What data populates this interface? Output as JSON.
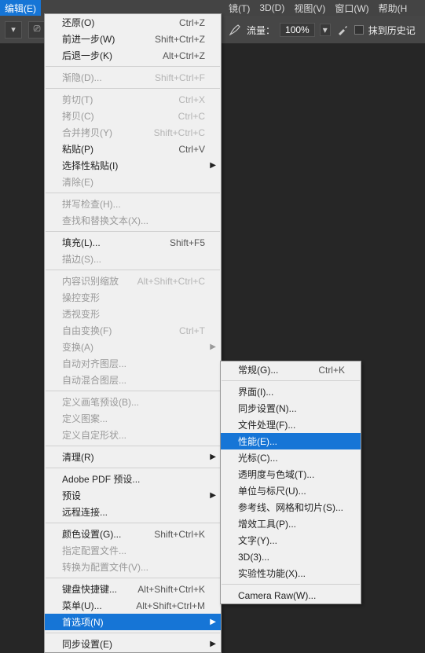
{
  "menubar": {
    "edit": "编辑(E)",
    "filter": "镜(T)",
    "three_d": "3D(D)",
    "view": "视图(V)",
    "window": "窗口(W)",
    "help": "帮助(H"
  },
  "toolbar": {
    "flow_label": "流量：",
    "flow_value": "100%",
    "history_label": "抹到历史记"
  },
  "editMenu": [
    [
      {
        "l": "还原(O)",
        "s": "Ctrl+Z"
      },
      {
        "l": "前进一步(W)",
        "s": "Shift+Ctrl+Z"
      },
      {
        "l": "后退一步(K)",
        "s": "Alt+Ctrl+Z"
      }
    ],
    [
      {
        "l": "渐隐(D)...",
        "s": "Shift+Ctrl+F",
        "d": true
      }
    ],
    [
      {
        "l": "剪切(T)",
        "s": "Ctrl+X",
        "d": true
      },
      {
        "l": "拷贝(C)",
        "s": "Ctrl+C",
        "d": true
      },
      {
        "l": "合并拷贝(Y)",
        "s": "Shift+Ctrl+C",
        "d": true
      },
      {
        "l": "粘贴(P)",
        "s": "Ctrl+V"
      },
      {
        "l": "选择性粘贴(I)",
        "sub": true
      },
      {
        "l": "清除(E)",
        "d": true
      }
    ],
    [
      {
        "l": "拼写检查(H)...",
        "d": true
      },
      {
        "l": "查找和替换文本(X)...",
        "d": true
      }
    ],
    [
      {
        "l": "填充(L)...",
        "s": "Shift+F5"
      },
      {
        "l": "描边(S)...",
        "d": true
      }
    ],
    [
      {
        "l": "内容识别缩放",
        "s": "Alt+Shift+Ctrl+C",
        "d": true
      },
      {
        "l": "操控变形",
        "d": true
      },
      {
        "l": "透视变形",
        "d": true
      },
      {
        "l": "自由变换(F)",
        "s": "Ctrl+T",
        "d": true
      },
      {
        "l": "变换(A)",
        "d": true,
        "sub": true
      },
      {
        "l": "自动对齐图层...",
        "d": true
      },
      {
        "l": "自动混合图层...",
        "d": true
      }
    ],
    [
      {
        "l": "定义画笔预设(B)...",
        "d": true
      },
      {
        "l": "定义图案...",
        "d": true
      },
      {
        "l": "定义自定形状...",
        "d": true
      }
    ],
    [
      {
        "l": "清理(R)",
        "sub": true
      }
    ],
    [
      {
        "l": "Adobe PDF 预设..."
      },
      {
        "l": "预设",
        "sub": true
      },
      {
        "l": "远程连接..."
      }
    ],
    [
      {
        "l": "颜色设置(G)...",
        "s": "Shift+Ctrl+K"
      },
      {
        "l": "指定配置文件...",
        "d": true
      },
      {
        "l": "转换为配置文件(V)...",
        "d": true
      }
    ],
    [
      {
        "l": "键盘快捷键...",
        "s": "Alt+Shift+Ctrl+K"
      },
      {
        "l": "菜单(U)...",
        "s": "Alt+Shift+Ctrl+M"
      },
      {
        "l": "首选项(N)",
        "sub": true,
        "hl": true
      }
    ],
    [
      {
        "l": "同步设置(E)",
        "sub": true
      }
    ]
  ],
  "prefMenu": [
    [
      {
        "l": "常规(G)...",
        "s": "Ctrl+K"
      }
    ],
    [
      {
        "l": "界面(I)..."
      },
      {
        "l": "同步设置(N)..."
      },
      {
        "l": "文件处理(F)..."
      },
      {
        "l": "性能(E)...",
        "hl": true
      },
      {
        "l": "光标(C)..."
      },
      {
        "l": "透明度与色域(T)..."
      },
      {
        "l": "单位与标尺(U)..."
      },
      {
        "l": "参考线、网格和切片(S)..."
      },
      {
        "l": "增效工具(P)..."
      },
      {
        "l": "文字(Y)..."
      },
      {
        "l": "3D(3)..."
      },
      {
        "l": "实验性功能(X)..."
      }
    ],
    [
      {
        "l": "Camera Raw(W)..."
      }
    ]
  ]
}
